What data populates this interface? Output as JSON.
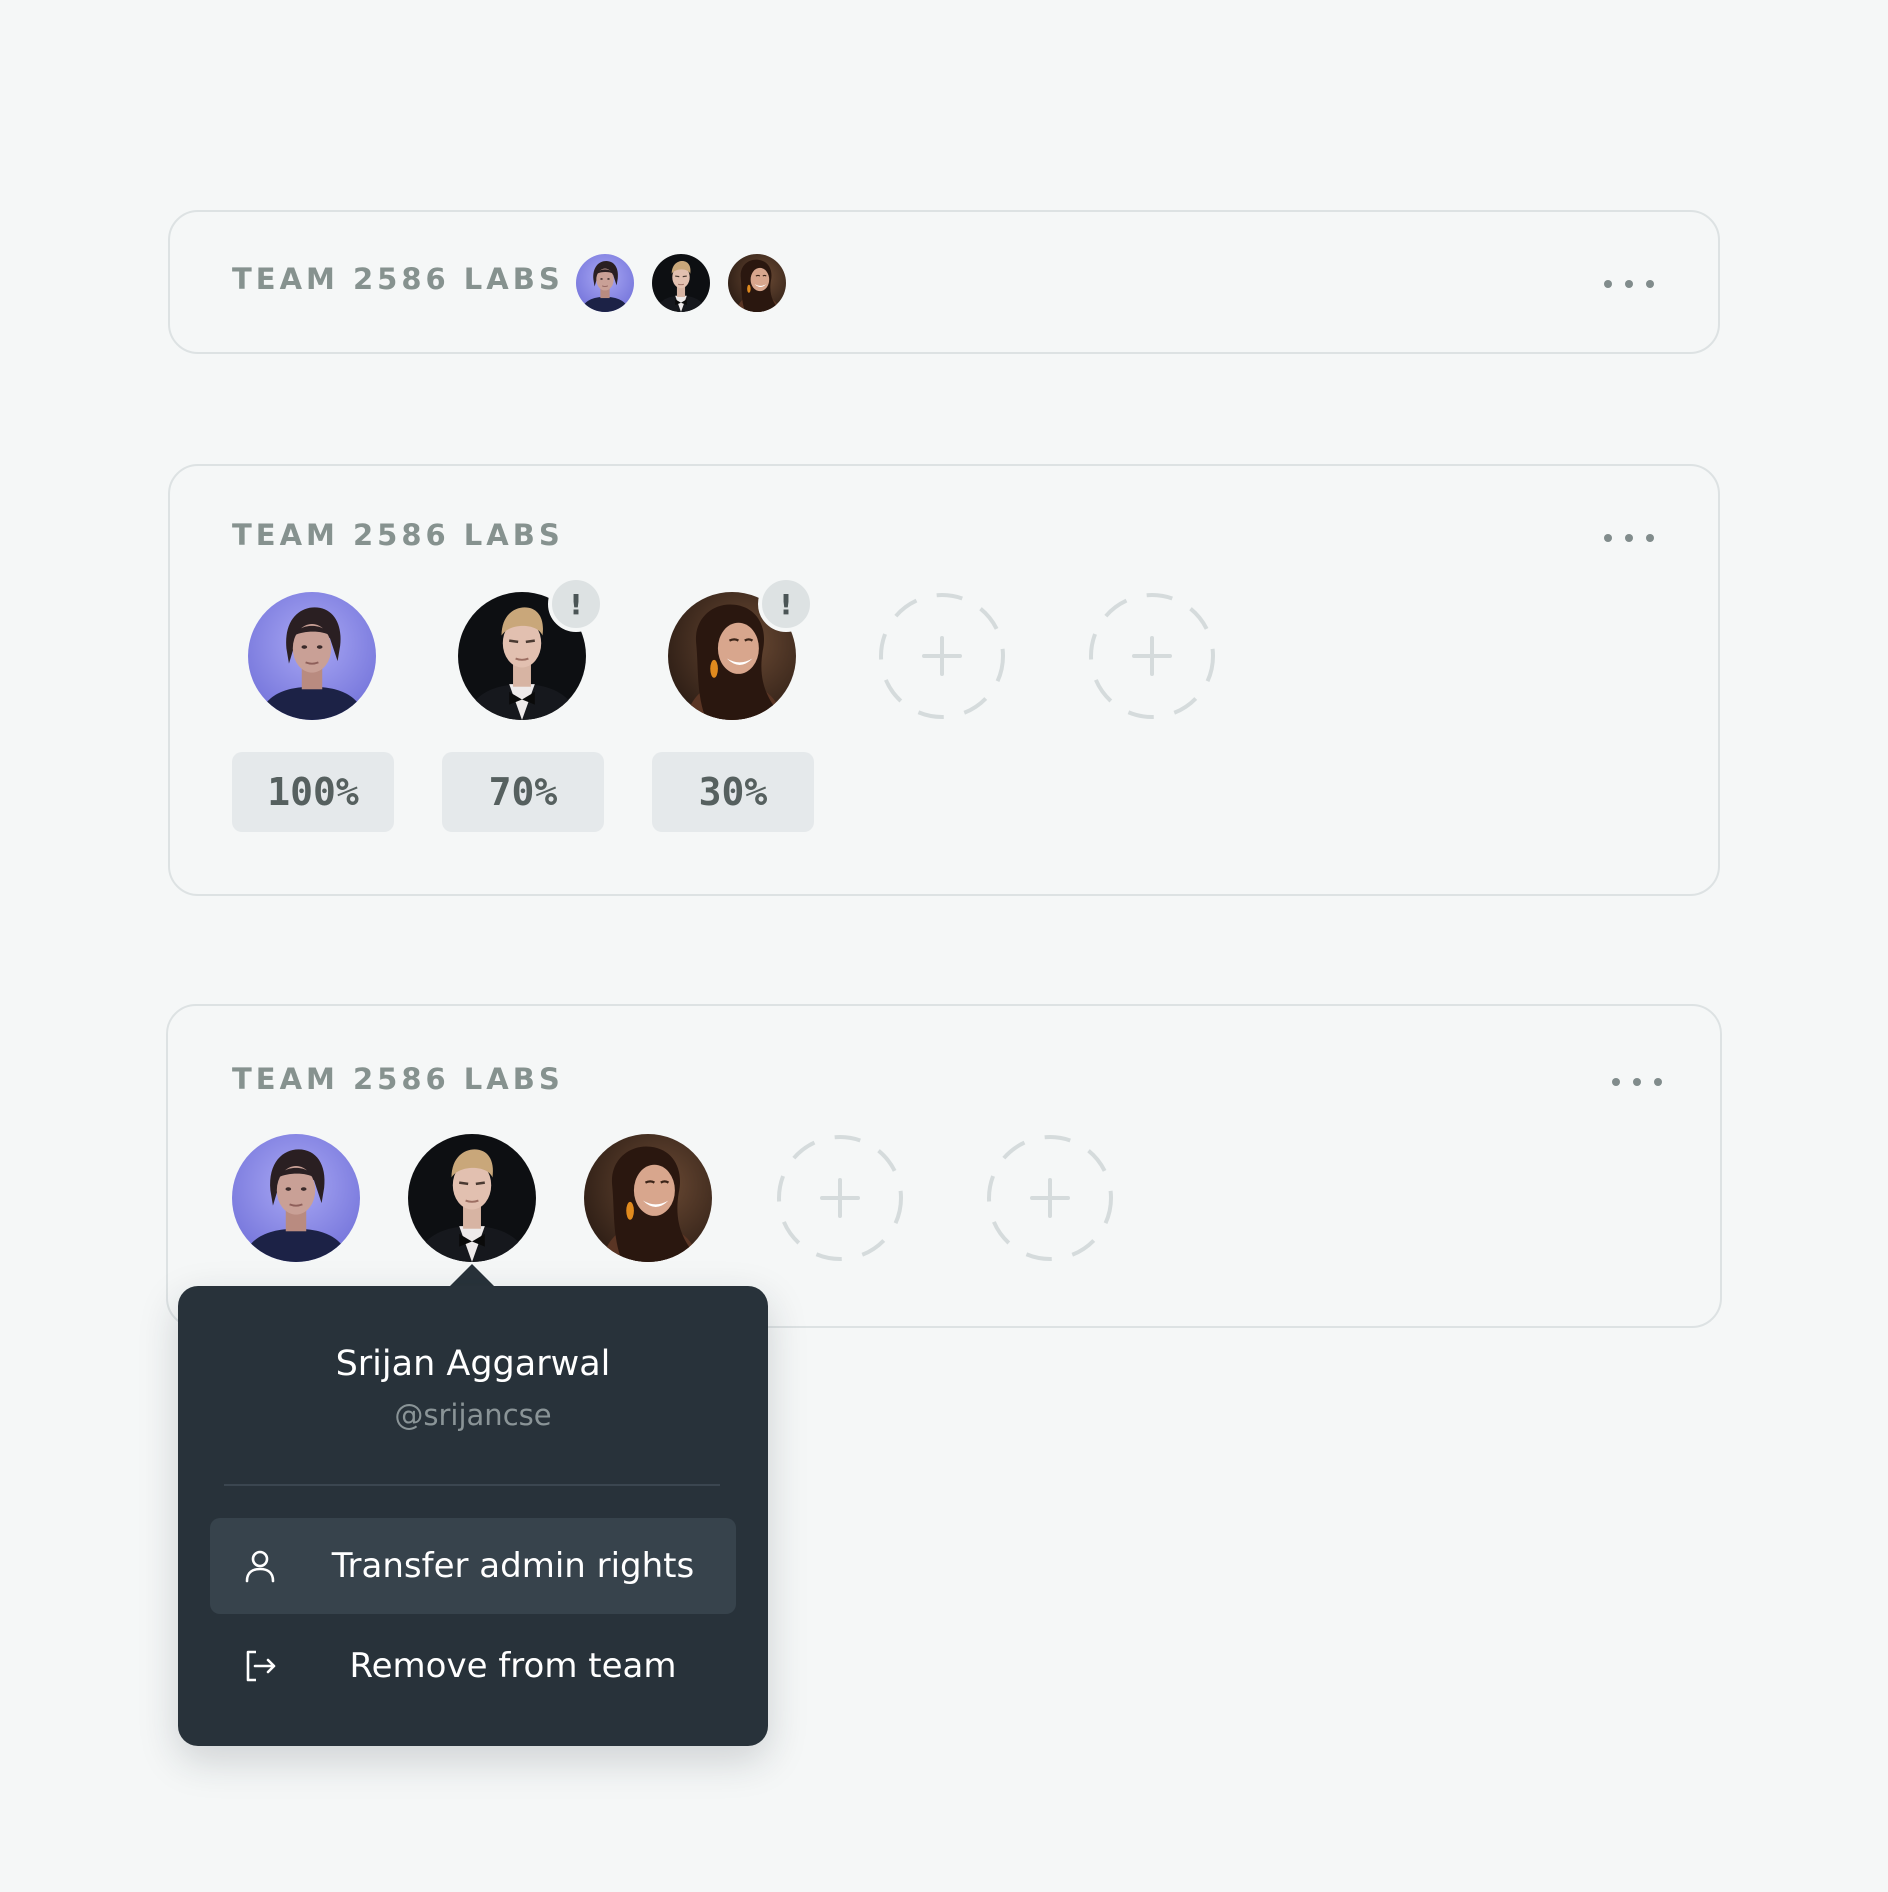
{
  "colors": {
    "background": "#f5f7f7",
    "card_border": "#dde2e3",
    "title": "#86928f",
    "popover_bg": "#28323a",
    "menu_active": "#37434c"
  },
  "cards": [
    {
      "title": "TEAM 2586 LABS",
      "more_icon": "ellipsis-horizontal-icon",
      "members": [
        "woman-blue-portrait",
        "man-tuxedo-portrait",
        "woman-smiling-portrait"
      ]
    },
    {
      "title": "TEAM 2586 LABS",
      "more_icon": "ellipsis-horizontal-icon",
      "members": [
        {
          "avatar": "woman-blue-portrait",
          "percent": "100%",
          "warning": false
        },
        {
          "avatar": "man-tuxedo-portrait",
          "percent": "70%",
          "warning": true,
          "badge": "!"
        },
        {
          "avatar": "woman-smiling-portrait",
          "percent": "30%",
          "warning": true,
          "badge": "!"
        }
      ],
      "empty_slots": 2,
      "slot_icon": "plus-icon"
    },
    {
      "title": "TEAM 2586 LABS",
      "more_icon": "ellipsis-horizontal-icon",
      "members": [
        "woman-blue-portrait",
        "man-tuxedo-portrait",
        "woman-smiling-portrait"
      ],
      "empty_slots": 2,
      "slot_icon": "plus-icon"
    }
  ],
  "popover": {
    "name": "Srijan Aggarwal",
    "handle": "@srijancse",
    "menu": [
      {
        "label": "Transfer admin rights",
        "icon": "user-icon",
        "active": true
      },
      {
        "label": "Remove from team",
        "icon": "logout-icon",
        "active": false
      }
    ]
  }
}
